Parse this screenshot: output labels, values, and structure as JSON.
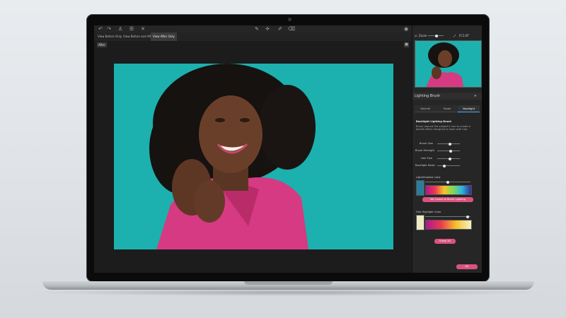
{
  "toolbar": {
    "icons": [
      "undo-icon",
      "redo-icon",
      "person-icon",
      "layers-icon",
      "close-icon",
      "brush-icon",
      "move-icon",
      "pen-icon",
      "eraser-icon",
      "eye-icon"
    ]
  },
  "view_tabs": [
    "View Before Only",
    "View Before and After",
    "View After Only"
  ],
  "active_view_tab": 2,
  "canvas": {
    "badge": "After"
  },
  "zoom": {
    "label": "Zoom",
    "value": "FC1:6T"
  },
  "panel": {
    "title": "Lighting Brush",
    "add_symbol": "+",
    "subtabs": [
      "Warmth",
      "Pastel",
      "Backlight"
    ],
    "active_subtab": 2,
    "heading": "Backlight Lighting Brush",
    "description": "Brush around the subject's hair to create a backlit effect designed to work with hair.",
    "sliders": [
      {
        "label": "Brush Size",
        "value": 0.55
      },
      {
        "label": "Brush Strength",
        "value": 0.6
      },
      {
        "label": "Hair Size",
        "value": 0.55
      },
      {
        "label": "Backlight Noise",
        "value": 0.3
      }
    ],
    "light_shadow_label": "Light/Shadow Color",
    "set_colors_button": "Set Colors to Brush Lighting",
    "hair_highlight_label": "Hair Highlight Color",
    "erase_all_button": "Erase All",
    "ok_button": "OK"
  },
  "colors": {
    "accent_pink": "#d9537e",
    "backdrop_teal": "#19aeac"
  }
}
